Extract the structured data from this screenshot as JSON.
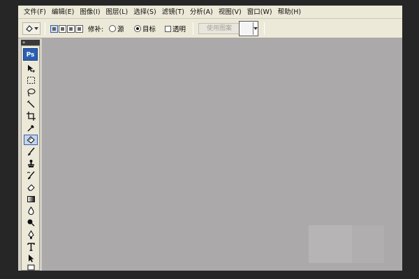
{
  "menu": [
    "文件(F)",
    "编辑(E)",
    "图像(I)",
    "图层(L)",
    "选择(S)",
    "滤镜(T)",
    "分析(A)",
    "视图(V)",
    "窗口(W)",
    "帮助(H)"
  ],
  "options": {
    "patch_label": "修补:",
    "source_label": "源",
    "destination_label": "目标",
    "destination_checked": true,
    "transparent_label": "透明",
    "transparent_checked": false,
    "use_pattern_label": "使用图案"
  },
  "toolbox": {
    "header": "»",
    "logo": "Ps",
    "active_tool": "patch-tool",
    "tools": [
      "move-tool",
      "marquee-tool",
      "lasso-tool",
      "quick-selection-tool",
      "crop-tool",
      "eyedropper-tool",
      "patch-tool",
      "brush-tool",
      "clone-stamp-tool",
      "history-brush-tool",
      "eraser-tool",
      "gradient-tool",
      "blur-tool",
      "dodge-tool",
      "pen-tool",
      "type-tool",
      "path-selection-tool",
      "shape-tool"
    ]
  },
  "colors": {
    "canvas": "#aba9aa",
    "toolbar": "#ece9d8",
    "ps_logo": "#2b5fb3",
    "frame": "#262626"
  }
}
